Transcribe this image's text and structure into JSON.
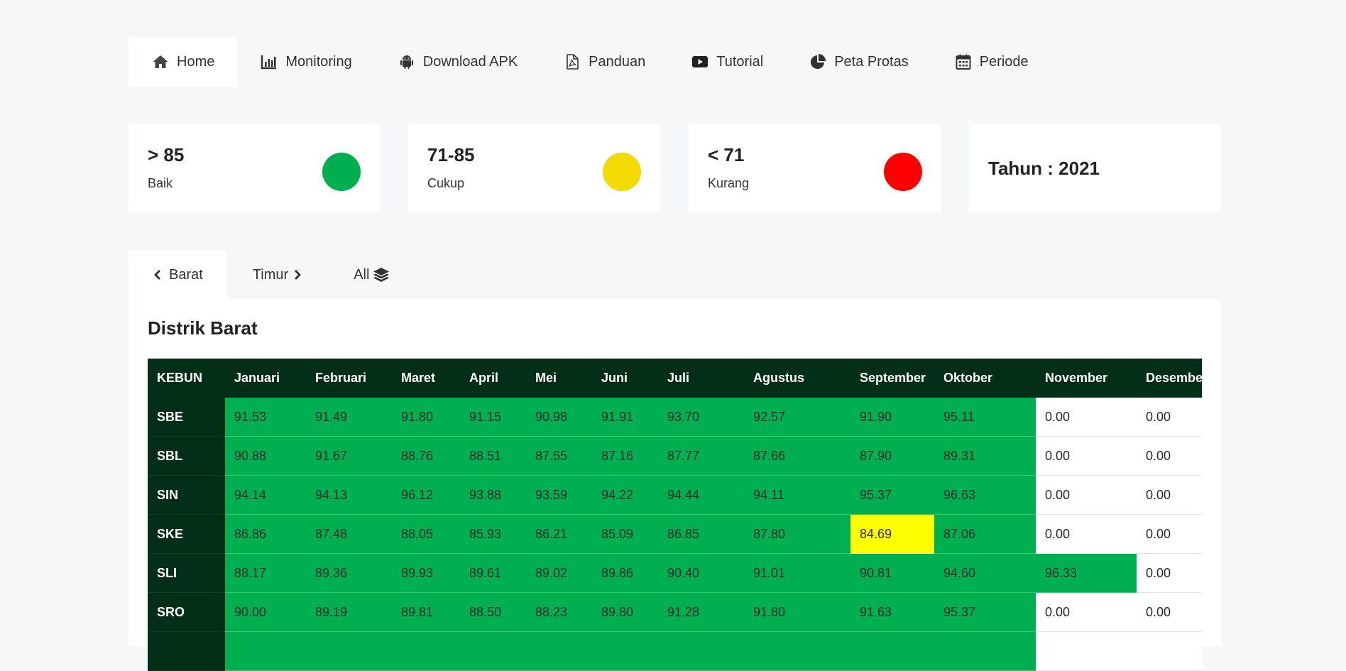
{
  "nav": {
    "items": [
      {
        "label": "Home",
        "icon": "home-icon"
      },
      {
        "label": "Monitoring",
        "icon": "bar-chart-icon"
      },
      {
        "label": "Download APK",
        "icon": "android-icon"
      },
      {
        "label": "Panduan",
        "icon": "pdf-file-icon"
      },
      {
        "label": "Tutorial",
        "icon": "youtube-icon"
      },
      {
        "label": "Peta Protas",
        "icon": "pie-chart-icon"
      },
      {
        "label": "Periode",
        "icon": "calendar-icon"
      }
    ],
    "active": "Home"
  },
  "legend": [
    {
      "score": "> 85",
      "label": "Baik",
      "color": "#00b050"
    },
    {
      "score": "71-85",
      "label": "Cukup",
      "color": "#f2d900"
    },
    {
      "score": "< 71",
      "label": "Kurang",
      "color": "#ff0000"
    }
  ],
  "year_card": {
    "text": "Tahun : 2021"
  },
  "tabs": [
    {
      "label": "Barat",
      "icon": "chevron-left-icon"
    },
    {
      "label": "Timur",
      "icon": "chevron-right-icon"
    },
    {
      "label": "All",
      "icon": "layers-icon"
    }
  ],
  "panel": {
    "title": "Distrik Barat",
    "columns": [
      "KEBUN",
      "Januari",
      "Februari",
      "Maret",
      "April",
      "Mei",
      "Juni",
      "Juli",
      "Agustus",
      "September",
      "Oktober",
      "November",
      "Desember"
    ],
    "rows": [
      {
        "kebun": "SBE",
        "values": [
          "91.53",
          "91.49",
          "91.80",
          "91.15",
          "90.98",
          "91.91",
          "93.70",
          "92.57",
          "91.90",
          "95.11",
          "0.00",
          "0.00"
        ],
        "status": [
          "g",
          "g",
          "g",
          "g",
          "g",
          "g",
          "g",
          "g",
          "g",
          "g",
          "w",
          "w"
        ]
      },
      {
        "kebun": "SBL",
        "values": [
          "90.88",
          "91.67",
          "88.76",
          "88.51",
          "87.55",
          "87.16",
          "87.77",
          "87.66",
          "87.90",
          "89.31",
          "0.00",
          "0.00"
        ],
        "status": [
          "g",
          "g",
          "g",
          "g",
          "g",
          "g",
          "g",
          "g",
          "g",
          "g",
          "w",
          "w"
        ]
      },
      {
        "kebun": "SIN",
        "values": [
          "94.14",
          "94.13",
          "96.12",
          "93.88",
          "93.59",
          "94.22",
          "94.44",
          "94.11",
          "95.37",
          "96.63",
          "0.00",
          "0.00"
        ],
        "status": [
          "g",
          "g",
          "g",
          "g",
          "g",
          "g",
          "g",
          "g",
          "g",
          "g",
          "w",
          "w"
        ]
      },
      {
        "kebun": "SKE",
        "values": [
          "86.86",
          "87.48",
          "88.05",
          "85.93",
          "86.21",
          "85.09",
          "86.85",
          "87.80",
          "84.69",
          "87.06",
          "0.00",
          "0.00"
        ],
        "status": [
          "g",
          "g",
          "g",
          "g",
          "g",
          "g",
          "g",
          "g",
          "y",
          "g",
          "w",
          "w"
        ]
      },
      {
        "kebun": "SLI",
        "values": [
          "88.17",
          "89.36",
          "89.93",
          "89.61",
          "89.02",
          "89.86",
          "90.40",
          "91.01",
          "90.81",
          "94.60",
          "96.33",
          "0.00"
        ],
        "status": [
          "g",
          "g",
          "g",
          "g",
          "g",
          "g",
          "g",
          "g",
          "g",
          "g",
          "g",
          "w"
        ]
      },
      {
        "kebun": "SRO",
        "values": [
          "90.00",
          "89.19",
          "89.81",
          "88.50",
          "88.23",
          "89.80",
          "91.28",
          "91.80",
          "91.63",
          "95.37",
          "0.00",
          "0.00"
        ],
        "status": [
          "g",
          "g",
          "g",
          "g",
          "g",
          "g",
          "g",
          "g",
          "g",
          "g",
          "w",
          "w"
        ]
      },
      {
        "kebun": "",
        "values": [
          "",
          "",
          "",
          "",
          "",
          "",
          "",
          "",
          "",
          "",
          "",
          ""
        ],
        "status": [
          "g",
          "g",
          "g",
          "g",
          "g",
          "g",
          "g",
          "g",
          "g",
          "g",
          "w",
          "w"
        ]
      }
    ]
  }
}
